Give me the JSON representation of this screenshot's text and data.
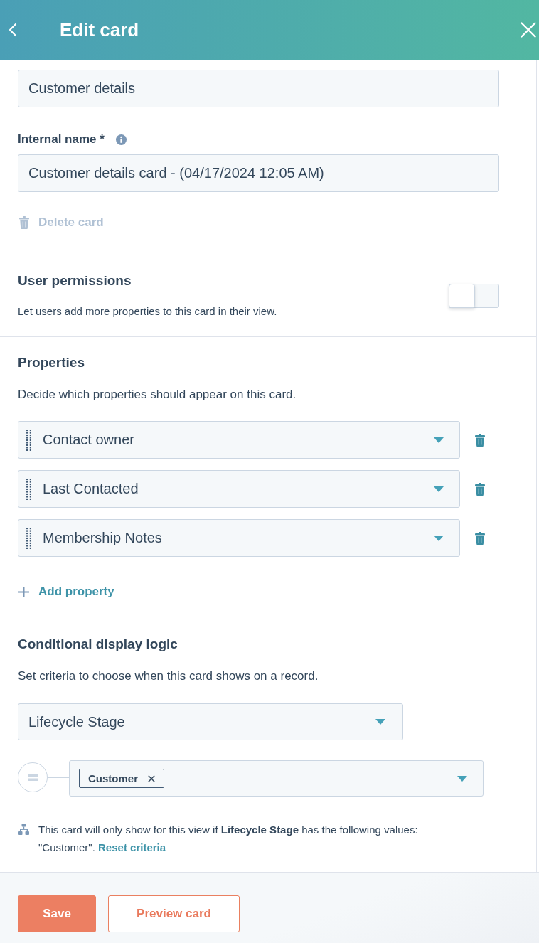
{
  "header": {
    "title": "Edit card"
  },
  "card_name_field": {
    "value": "Customer details"
  },
  "internal_name": {
    "label": "Internal name *",
    "value": "Customer details card - (04/17/2024 12:05 AM)"
  },
  "delete_card": {
    "label": "Delete card",
    "disabled": true
  },
  "user_permissions": {
    "title": "User permissions",
    "description": "Let users add more properties to this card in their view.",
    "toggle": {
      "on": false
    }
  },
  "properties": {
    "title": "Properties",
    "description": "Decide which properties should appear on this card.",
    "items": [
      {
        "value": "Contact owner"
      },
      {
        "value": "Last Contacted"
      },
      {
        "value": "Membership Notes"
      }
    ],
    "add_label": "Add property"
  },
  "conditional_logic": {
    "title": "Conditional display logic",
    "description": "Set criteria to choose when this card shows on a record.",
    "property_field": {
      "value": "Lifecycle Stage"
    },
    "value_field": {
      "tags": [
        {
          "label": "Customer"
        }
      ]
    },
    "note": "This card will only show for this view if **Lifecycle Stage** has the following values: \"Customer\".",
    "note_link": "Reset criteria"
  },
  "footer": {
    "buttons": [
      {
        "label": "Save",
        "kind": "primary"
      },
      {
        "label": "Preview card",
        "kind": "secondary"
      }
    ]
  }
}
